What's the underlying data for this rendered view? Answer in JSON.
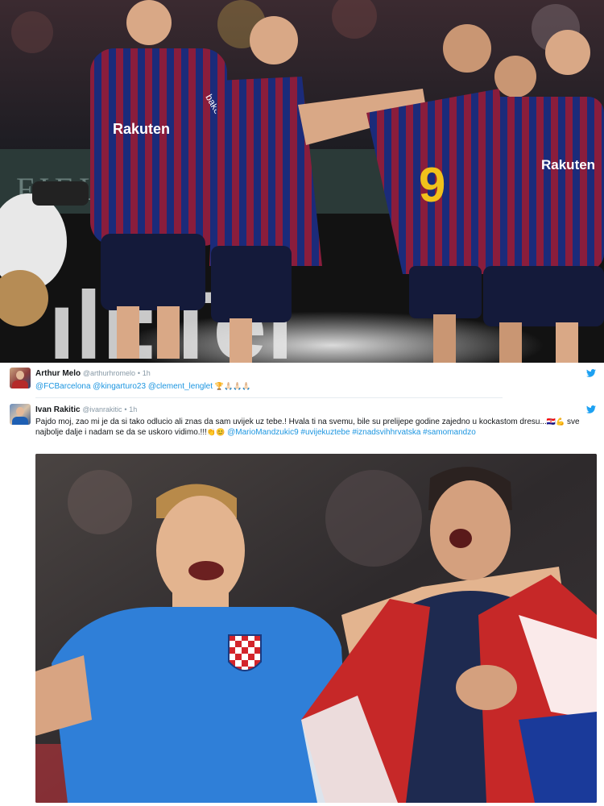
{
  "hero_photo": {
    "shirt_sponsor": "Rakuten",
    "shirt_sponsor_right": "Rakuten",
    "shirt_brand": "bakee",
    "player_number": "9",
    "stadium_sign": "FIELD RO"
  },
  "tweets": [
    {
      "name": "Arthur Melo",
      "handle": "@arthurhromelo",
      "separator": "•",
      "time": "1h",
      "mentions": [
        "@FCBarcelona",
        "@kingarturo23",
        "@clement_lenglet"
      ],
      "emojis": "🏆🙏🏻🙏🏻🙏🏻",
      "avatar_icon": "user-avatar-icon",
      "platform_icon": "twitter-bird-icon"
    },
    {
      "name": "Ivan Rakitic",
      "handle": "@ivanrakitic",
      "separator": "•",
      "time": "1h",
      "text_part1": "Pajdo moj, zao mi je da si tako odlucio ali znas da sam uvijek uz tebe.! Hvala ti na svemu, bile su prelijepe godine zajedno u kockastom dresu...",
      "emoji1": "🇭🇷💪",
      "text_part2": " sve najbolje dalje i nadam se da se uskoro vidimo.!!!",
      "emoji2": "👏😊",
      "mention": "@MarioMandzukic9",
      "hashtags": [
        "#uvijekuztebe",
        "#iznadsvihhrvatska",
        "#samomandzo"
      ],
      "avatar_icon": "user-avatar-icon",
      "platform_icon": "twitter-bird-icon"
    }
  ],
  "colors": {
    "link": "#1b95e0",
    "meta": "#8899a6",
    "barca_blue": "#1b2b7a",
    "barca_garnet": "#8a1d3c",
    "croatia_blue": "#2f7fd8",
    "twitter_blue": "#1da1f2"
  }
}
